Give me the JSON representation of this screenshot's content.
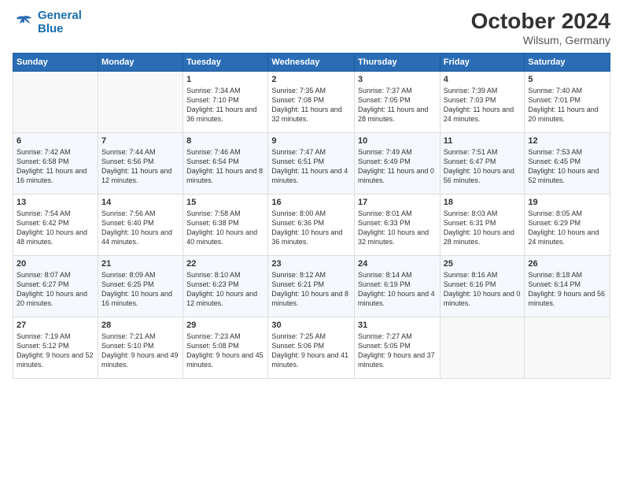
{
  "logo": {
    "line1": "General",
    "line2": "Blue"
  },
  "title": "October 2024",
  "location": "Wilsum, Germany",
  "headers": [
    "Sunday",
    "Monday",
    "Tuesday",
    "Wednesday",
    "Thursday",
    "Friday",
    "Saturday"
  ],
  "weeks": [
    [
      {
        "day": "",
        "sunrise": "",
        "sunset": "",
        "daylight": ""
      },
      {
        "day": "",
        "sunrise": "",
        "sunset": "",
        "daylight": ""
      },
      {
        "day": "1",
        "sunrise": "Sunrise: 7:34 AM",
        "sunset": "Sunset: 7:10 PM",
        "daylight": "Daylight: 11 hours and 36 minutes."
      },
      {
        "day": "2",
        "sunrise": "Sunrise: 7:35 AM",
        "sunset": "Sunset: 7:08 PM",
        "daylight": "Daylight: 11 hours and 32 minutes."
      },
      {
        "day": "3",
        "sunrise": "Sunrise: 7:37 AM",
        "sunset": "Sunset: 7:05 PM",
        "daylight": "Daylight: 11 hours and 28 minutes."
      },
      {
        "day": "4",
        "sunrise": "Sunrise: 7:39 AM",
        "sunset": "Sunset: 7:03 PM",
        "daylight": "Daylight: 11 hours and 24 minutes."
      },
      {
        "day": "5",
        "sunrise": "Sunrise: 7:40 AM",
        "sunset": "Sunset: 7:01 PM",
        "daylight": "Daylight: 11 hours and 20 minutes."
      }
    ],
    [
      {
        "day": "6",
        "sunrise": "Sunrise: 7:42 AM",
        "sunset": "Sunset: 6:58 PM",
        "daylight": "Daylight: 11 hours and 16 minutes."
      },
      {
        "day": "7",
        "sunrise": "Sunrise: 7:44 AM",
        "sunset": "Sunset: 6:56 PM",
        "daylight": "Daylight: 11 hours and 12 minutes."
      },
      {
        "day": "8",
        "sunrise": "Sunrise: 7:46 AM",
        "sunset": "Sunset: 6:54 PM",
        "daylight": "Daylight: 11 hours and 8 minutes."
      },
      {
        "day": "9",
        "sunrise": "Sunrise: 7:47 AM",
        "sunset": "Sunset: 6:51 PM",
        "daylight": "Daylight: 11 hours and 4 minutes."
      },
      {
        "day": "10",
        "sunrise": "Sunrise: 7:49 AM",
        "sunset": "Sunset: 6:49 PM",
        "daylight": "Daylight: 11 hours and 0 minutes."
      },
      {
        "day": "11",
        "sunrise": "Sunrise: 7:51 AM",
        "sunset": "Sunset: 6:47 PM",
        "daylight": "Daylight: 10 hours and 56 minutes."
      },
      {
        "day": "12",
        "sunrise": "Sunrise: 7:53 AM",
        "sunset": "Sunset: 6:45 PM",
        "daylight": "Daylight: 10 hours and 52 minutes."
      }
    ],
    [
      {
        "day": "13",
        "sunrise": "Sunrise: 7:54 AM",
        "sunset": "Sunset: 6:42 PM",
        "daylight": "Daylight: 10 hours and 48 minutes."
      },
      {
        "day": "14",
        "sunrise": "Sunrise: 7:56 AM",
        "sunset": "Sunset: 6:40 PM",
        "daylight": "Daylight: 10 hours and 44 minutes."
      },
      {
        "day": "15",
        "sunrise": "Sunrise: 7:58 AM",
        "sunset": "Sunset: 6:38 PM",
        "daylight": "Daylight: 10 hours and 40 minutes."
      },
      {
        "day": "16",
        "sunrise": "Sunrise: 8:00 AM",
        "sunset": "Sunset: 6:36 PM",
        "daylight": "Daylight: 10 hours and 36 minutes."
      },
      {
        "day": "17",
        "sunrise": "Sunrise: 8:01 AM",
        "sunset": "Sunset: 6:33 PM",
        "daylight": "Daylight: 10 hours and 32 minutes."
      },
      {
        "day": "18",
        "sunrise": "Sunrise: 8:03 AM",
        "sunset": "Sunset: 6:31 PM",
        "daylight": "Daylight: 10 hours and 28 minutes."
      },
      {
        "day": "19",
        "sunrise": "Sunrise: 8:05 AM",
        "sunset": "Sunset: 6:29 PM",
        "daylight": "Daylight: 10 hours and 24 minutes."
      }
    ],
    [
      {
        "day": "20",
        "sunrise": "Sunrise: 8:07 AM",
        "sunset": "Sunset: 6:27 PM",
        "daylight": "Daylight: 10 hours and 20 minutes."
      },
      {
        "day": "21",
        "sunrise": "Sunrise: 8:09 AM",
        "sunset": "Sunset: 6:25 PM",
        "daylight": "Daylight: 10 hours and 16 minutes."
      },
      {
        "day": "22",
        "sunrise": "Sunrise: 8:10 AM",
        "sunset": "Sunset: 6:23 PM",
        "daylight": "Daylight: 10 hours and 12 minutes."
      },
      {
        "day": "23",
        "sunrise": "Sunrise: 8:12 AM",
        "sunset": "Sunset: 6:21 PM",
        "daylight": "Daylight: 10 hours and 8 minutes."
      },
      {
        "day": "24",
        "sunrise": "Sunrise: 8:14 AM",
        "sunset": "Sunset: 6:19 PM",
        "daylight": "Daylight: 10 hours and 4 minutes."
      },
      {
        "day": "25",
        "sunrise": "Sunrise: 8:16 AM",
        "sunset": "Sunset: 6:16 PM",
        "daylight": "Daylight: 10 hours and 0 minutes."
      },
      {
        "day": "26",
        "sunrise": "Sunrise: 8:18 AM",
        "sunset": "Sunset: 6:14 PM",
        "daylight": "Daylight: 9 hours and 56 minutes."
      }
    ],
    [
      {
        "day": "27",
        "sunrise": "Sunrise: 7:19 AM",
        "sunset": "Sunset: 5:12 PM",
        "daylight": "Daylight: 9 hours and 52 minutes."
      },
      {
        "day": "28",
        "sunrise": "Sunrise: 7:21 AM",
        "sunset": "Sunset: 5:10 PM",
        "daylight": "Daylight: 9 hours and 49 minutes."
      },
      {
        "day": "29",
        "sunrise": "Sunrise: 7:23 AM",
        "sunset": "Sunset: 5:08 PM",
        "daylight": "Daylight: 9 hours and 45 minutes."
      },
      {
        "day": "30",
        "sunrise": "Sunrise: 7:25 AM",
        "sunset": "Sunset: 5:06 PM",
        "daylight": "Daylight: 9 hours and 41 minutes."
      },
      {
        "day": "31",
        "sunrise": "Sunrise: 7:27 AM",
        "sunset": "Sunset: 5:05 PM",
        "daylight": "Daylight: 9 hours and 37 minutes."
      },
      {
        "day": "",
        "sunrise": "",
        "sunset": "",
        "daylight": ""
      },
      {
        "day": "",
        "sunrise": "",
        "sunset": "",
        "daylight": ""
      }
    ]
  ]
}
